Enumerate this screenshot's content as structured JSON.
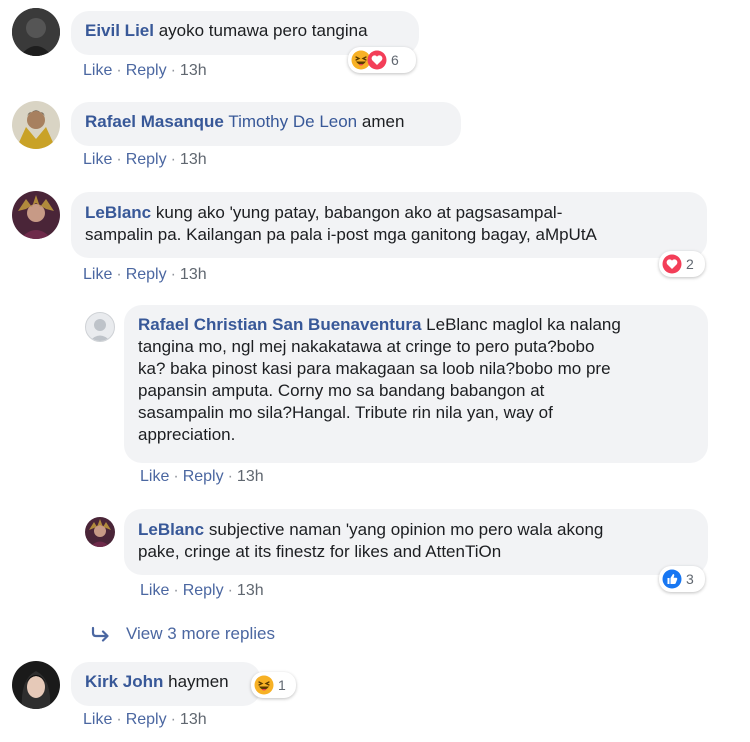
{
  "comments": [
    {
      "author": "Eivil Liel",
      "text": "ayoko tumawa pero tangina",
      "actions": {
        "like": "Like",
        "reply": "Reply",
        "time": "13h"
      },
      "reactions": {
        "icons": [
          "haha-icon",
          "love-icon"
        ],
        "count": "6"
      }
    },
    {
      "author": "Rafael Masanque",
      "tag": "Timothy De Leon",
      "text": "amen",
      "actions": {
        "like": "Like",
        "reply": "Reply",
        "time": "13h"
      }
    },
    {
      "author": "LeBlanc",
      "text_line1": "kung ako 'yung patay, babangon ako at pagsasampal-",
      "text_line2": "sampalin pa. Kailangan pa pala i-post mga ganitong bagay, aMpUtA",
      "actions": {
        "like": "Like",
        "reply": "Reply",
        "time": "13h"
      },
      "reactions": {
        "icons": [
          "love-icon"
        ],
        "count": "2"
      },
      "replies": [
        {
          "author": "Rafael Christian San Buenaventura",
          "lines": [
            "LeBlanc maglol ka nalang",
            "tangina mo, ngl mej nakakatawa at cringe to pero puta?bobo",
            "ka? baka pinost kasi para makagaan sa loob nila?bobo mo pre",
            "papansin amputa. Corny mo sa bandang babangon at",
            "sasampalin mo sila?Hangal. Tribute rin nila yan, way of",
            "appreciation."
          ],
          "actions": {
            "like": "Like",
            "reply": "Reply",
            "time": "13h"
          }
        },
        {
          "author": "LeBlanc",
          "lines": [
            "subjective naman 'yang opinion mo pero wala akong",
            "pake, cringe at its finestz for likes and AttenTiOn"
          ],
          "actions": {
            "like": "Like",
            "reply": "Reply",
            "time": "13h"
          },
          "reactions": {
            "icons": [
              "like-icon"
            ],
            "count": "3"
          }
        }
      ],
      "more_replies": "View 3 more replies"
    },
    {
      "author": "Kirk John",
      "text": "haymen",
      "actions": {
        "like": "Like",
        "reply": "Reply",
        "time": "13h"
      },
      "reactions": {
        "icons": [
          "haha-icon"
        ],
        "count": "1"
      }
    }
  ],
  "colors": {
    "author": "#385898",
    "link": "#4b67a1",
    "bubble": "#f2f3f5",
    "love": "#f33e58",
    "like": "#1877f2",
    "haha": "#f7b125"
  }
}
